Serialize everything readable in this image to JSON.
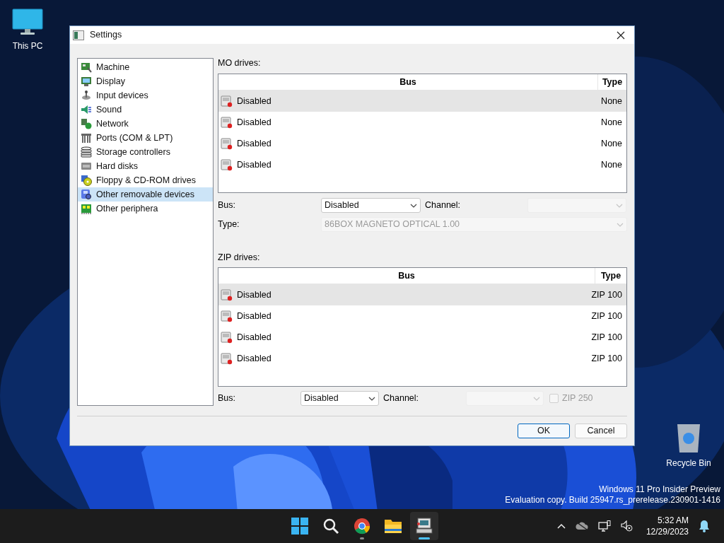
{
  "desktop_icons": [
    {
      "label": "This PC",
      "kind": "computer"
    },
    {
      "label": "Recycle Bin",
      "kind": "bin"
    }
  ],
  "window": {
    "title": "Settings"
  },
  "sidebar": {
    "items": [
      {
        "label": "Machine",
        "kind": "machine",
        "selected": false
      },
      {
        "label": "Display",
        "kind": "display",
        "selected": false
      },
      {
        "label": "Input devices",
        "kind": "input",
        "selected": false
      },
      {
        "label": "Sound",
        "kind": "sound",
        "selected": false
      },
      {
        "label": "Network",
        "kind": "network",
        "selected": false
      },
      {
        "label": "Ports (COM & LPT)",
        "kind": "ports",
        "selected": false
      },
      {
        "label": "Storage controllers",
        "kind": "storage",
        "selected": false
      },
      {
        "label": "Hard disks",
        "kind": "hdd",
        "selected": false
      },
      {
        "label": "Floppy & CD-ROM drives",
        "kind": "floppy",
        "selected": false
      },
      {
        "label": "Other removable devices",
        "kind": "removable",
        "selected": true
      },
      {
        "label": "Other periphera",
        "kind": "peripherals",
        "selected": false
      }
    ]
  },
  "mo": {
    "label": "MO drives:",
    "columns": [
      "Bus",
      "Type"
    ],
    "rows": [
      {
        "bus": "Disabled",
        "type": "None",
        "selected": true
      },
      {
        "bus": "Disabled",
        "type": "None",
        "selected": false
      },
      {
        "bus": "Disabled",
        "type": "None",
        "selected": false
      },
      {
        "bus": "Disabled",
        "type": "None",
        "selected": false
      }
    ],
    "bus": {
      "label": "Bus:",
      "value": "Disabled",
      "disabled": false
    },
    "channel": {
      "label": "Channel:",
      "disabled": true
    },
    "type": {
      "label": "Type:",
      "value": "86BOX MAGNETO OPTICAL 1.00",
      "disabled": true
    }
  },
  "zip": {
    "label": "ZIP drives:",
    "columns": [
      "Bus",
      "Type"
    ],
    "rows": [
      {
        "bus": "Disabled",
        "type": "ZIP 100",
        "selected": true
      },
      {
        "bus": "Disabled",
        "type": "ZIP 100",
        "selected": false
      },
      {
        "bus": "Disabled",
        "type": "ZIP 100",
        "selected": false
      },
      {
        "bus": "Disabled",
        "type": "ZIP 100",
        "selected": false
      }
    ],
    "bus": {
      "label": "Bus:",
      "value": "Disabled",
      "disabled": false
    },
    "channel": {
      "label": "Channel:",
      "disabled": true
    },
    "zip250": {
      "label": "ZIP 250",
      "checked": false,
      "disabled": true
    }
  },
  "buttons": [
    {
      "label": "OK",
      "default": true
    },
    {
      "label": "Cancel",
      "default": false
    }
  ],
  "watermark_os": [
    "Windows 11 Pro Insider Preview",
    "Evaluation copy. Build 25947.rs_prerelease.230901-1416"
  ],
  "taskbar": {
    "apps": [
      {
        "kind": "start",
        "running": false,
        "active": false
      },
      {
        "kind": "search",
        "running": false,
        "active": false
      },
      {
        "kind": "browser",
        "running": true,
        "active": false
      },
      {
        "kind": "folder",
        "running": false,
        "active": false
      },
      {
        "kind": "emulator",
        "running": true,
        "active": true
      }
    ],
    "time": "5:32 AM",
    "date": "12/29/2023"
  }
}
